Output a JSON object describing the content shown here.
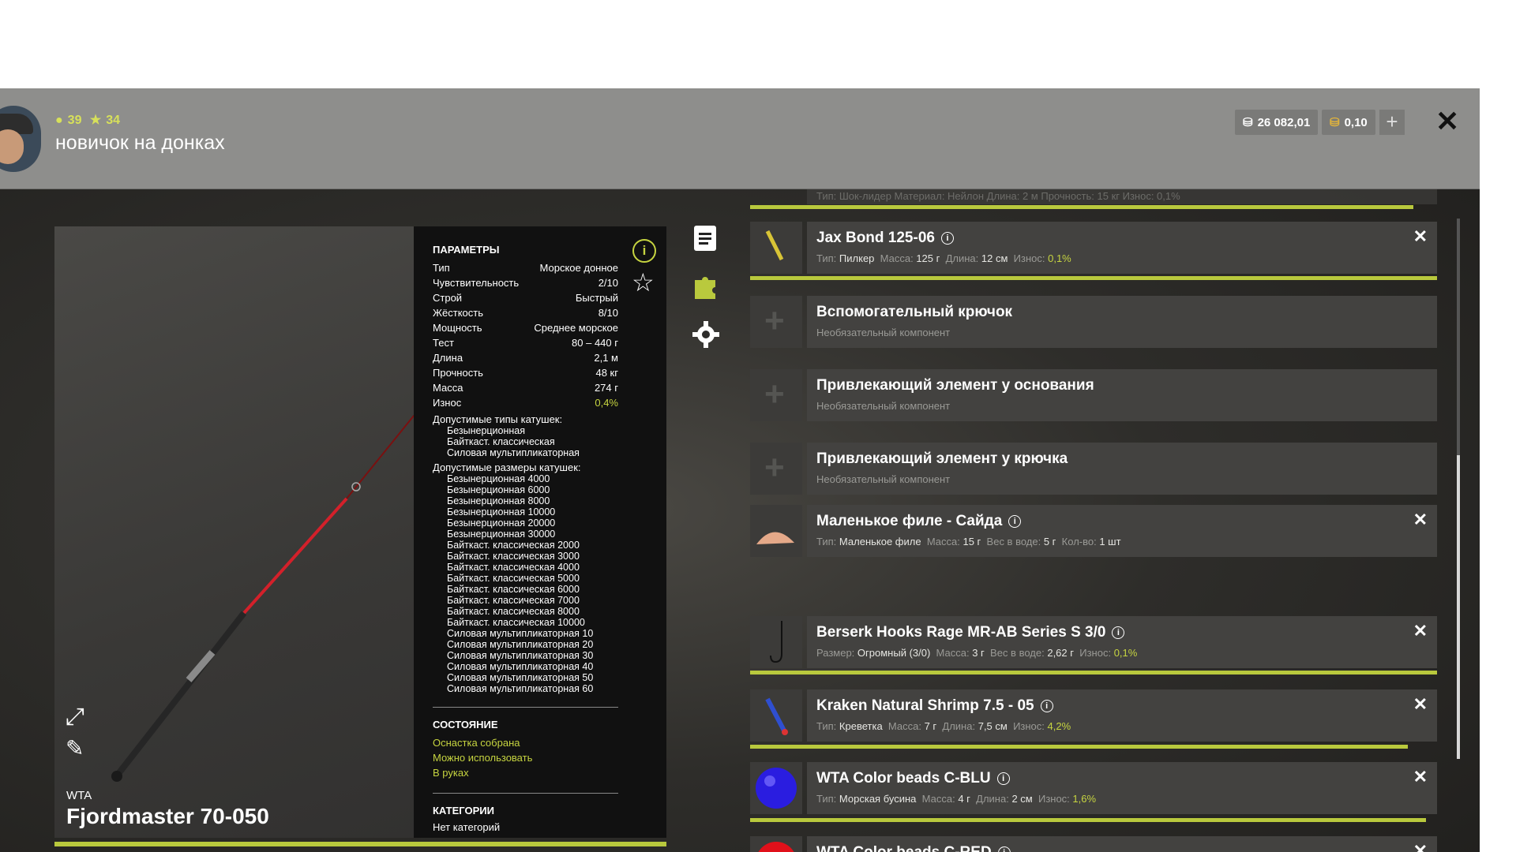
{
  "header": {
    "level": "39",
    "stars": "34",
    "nickname": "новичок на донках",
    "silver": "26 082,01",
    "gold": "0,10"
  },
  "item": {
    "brand": "WTA",
    "name": "Fjordmaster 70-050"
  },
  "params": {
    "heading": "ПАРАМЕТРЫ",
    "rows": [
      {
        "label": "Тип",
        "value": "Морское донное"
      },
      {
        "label": "Чувствительность",
        "value": "2/10"
      },
      {
        "label": "Строй",
        "value": "Быстрый"
      },
      {
        "label": "Жёсткость",
        "value": "8/10"
      },
      {
        "label": "Мощность",
        "value": "Среднее морское"
      },
      {
        "label": "Тест",
        "value": "80 – 440 г"
      },
      {
        "label": "Длина",
        "value": "2,1 м"
      },
      {
        "label": "Прочность",
        "value": "48 кг"
      },
      {
        "label": "Масса",
        "value": "274 г"
      },
      {
        "label": "Износ",
        "value": "0,4%"
      }
    ],
    "reel_types_heading": "Допустимые типы катушек:",
    "reel_types": [
      "Безынерционная",
      "Байткаст. классическая",
      "Силовая мультипликаторная"
    ],
    "reel_sizes_heading": "Допустимые размеры катушек:",
    "reel_sizes": [
      "Безынерционная 4000",
      "Безынерционная 6000",
      "Безынерционная 8000",
      "Безынерционная 10000",
      "Безынерционная 20000",
      "Безынерционная 30000",
      "Байткаст. классическая 2000",
      "Байткаст. классическая 3000",
      "Байткаст. классическая 4000",
      "Байткаст. классическая 5000",
      "Байткаст. классическая 6000",
      "Байткаст. классическая 7000",
      "Байткаст. классическая 8000",
      "Байткаст. классическая 10000",
      "Силовая мультипликаторная 10",
      "Силовая мультипликаторная 20",
      "Силовая мультипликаторная 30",
      "Силовая мультипликаторная 40",
      "Силовая мультипликаторная 50",
      "Силовая мультипликаторная 60"
    ],
    "state_heading": "СОСТОЯНИЕ",
    "state": [
      "Оснастка собрана",
      "Можно использовать",
      "В руках"
    ],
    "categories_heading": "КАТЕГОРИИ",
    "categories": "Нет категорий"
  },
  "slots": {
    "partial_row": "Тип: Шок-лидер  Материал: Нейлон  Длина: 2 м  Прочность: 15 кг  Износ: 0,1%",
    "jax": {
      "title": "Jax Bond 125-06",
      "sub1": "Тип:",
      "sub1v": "Пилкер",
      "sub2": "Масса:",
      "sub2v": "125 г",
      "sub3": "Длина:",
      "sub3v": "12 см",
      "sub4": "Износ:",
      "sub4v": "0,1%",
      "wear": 0.99
    },
    "aux_hook": {
      "title": "Вспомогательный крючок",
      "sub": "Необязательный компонент"
    },
    "attr_base": {
      "title": "Привлекающий элемент у основания",
      "sub": "Необязательный компонент"
    },
    "attr_hook": {
      "title": "Привлекающий элемент у крючка",
      "sub": "Необязательный компонент"
    },
    "fillet": {
      "title": "Маленькое филе - Сайда",
      "sub1": "Тип:",
      "sub1v": "Маленькое филе",
      "sub2": "Масса:",
      "sub2v": "15 г",
      "sub3": "Вес в воде:",
      "sub3v": "5 г",
      "sub4": "Кол-во:",
      "sub4v": "1 шт"
    },
    "hook": {
      "title": "Berserk Hooks Rage MR-AB Series S 3/0",
      "sub1": "Размер:",
      "sub1v": "Огромный (3/0)",
      "sub2": "Масса:",
      "sub2v": "3 г",
      "sub3": "Вес в воде:",
      "sub3v": "2,62 г",
      "sub4": "Износ:",
      "sub4v": "0,1%",
      "wear": 0.99
    },
    "shrimp": {
      "title": "Kraken Natural Shrimp 7.5 - 05",
      "sub1": "Тип:",
      "sub1v": "Креветка",
      "sub2": "Масса:",
      "sub2v": "7 г",
      "sub3": "Длина:",
      "sub3v": "7,5 см",
      "sub4": "Износ:",
      "sub4v": "4,2%",
      "wear": 0.958
    },
    "blu": {
      "title": "WTA Color beads C-BLU",
      "sub1": "Тип:",
      "sub1v": "Морская бусина",
      "sub2": "Масса:",
      "sub2v": "4 г",
      "sub3": "Длина:",
      "sub3v": "2 см",
      "sub4": "Износ:",
      "sub4v": "1,6%",
      "wear": 0.984
    },
    "red": {
      "title": "WTA Color beads C-RED"
    }
  },
  "icons": [
    "info-icon",
    "star-icon",
    "list-icon",
    "puzzle-icon",
    "gear-icon",
    "expand-icon",
    "brush-icon",
    "close-icon",
    "plus-icon"
  ],
  "colors": {
    "accent": "#c6d440",
    "wear_bar": "#b9c93d",
    "header": "#8e8e8c",
    "panel": "#111111"
  }
}
